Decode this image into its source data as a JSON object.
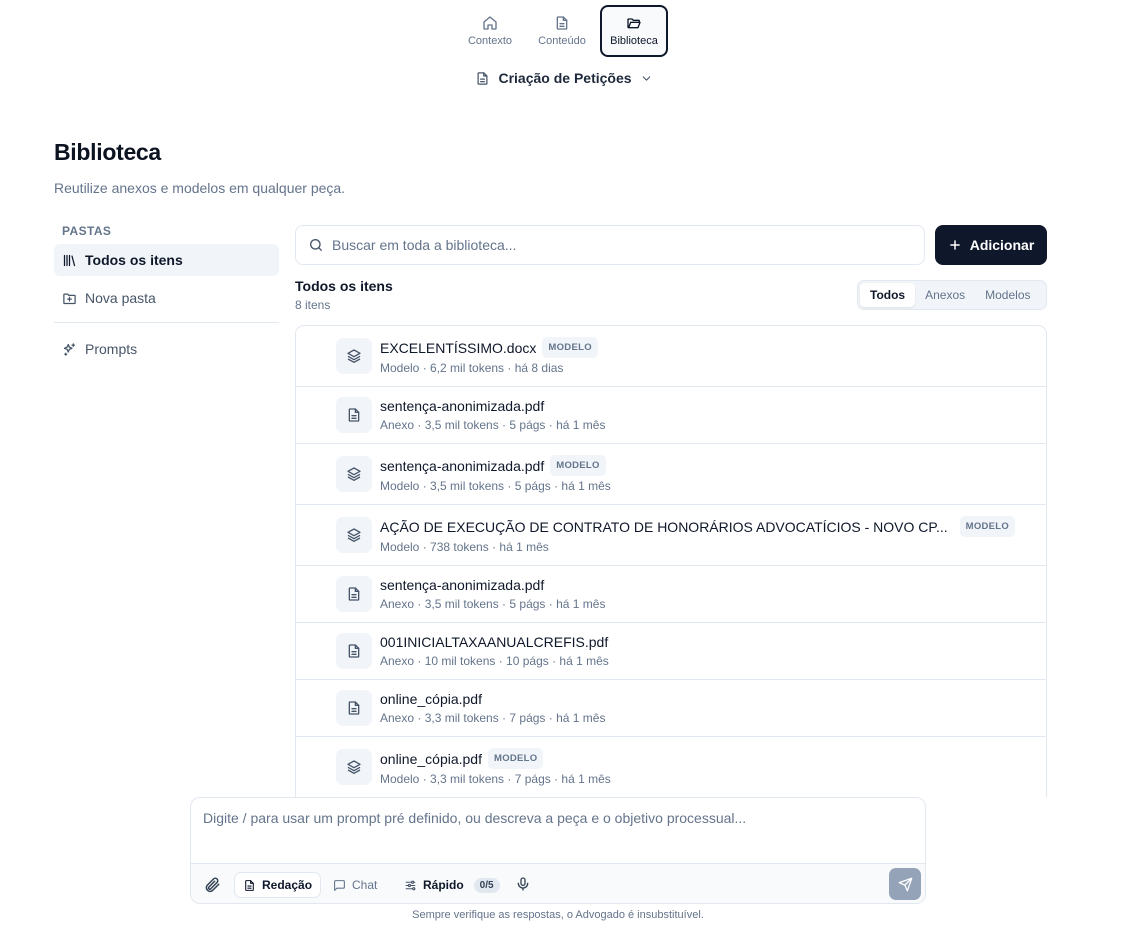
{
  "topnav": {
    "tabs": [
      {
        "label": "Contexto",
        "icon": "home-icon",
        "active": false
      },
      {
        "label": "Conteúdo",
        "icon": "document-icon",
        "active": false
      },
      {
        "label": "Biblioteca",
        "icon": "folder-open-icon",
        "active": true
      }
    ]
  },
  "case": {
    "title": "Criação de Petições"
  },
  "page": {
    "title": "Biblioteca",
    "subtitle": "Reutilize anexos e modelos em qualquer peça."
  },
  "sidebar": {
    "section": "PASTAS",
    "items": [
      {
        "label": "Todos os itens",
        "icon": "library-icon",
        "active": true
      },
      {
        "label": "Nova pasta",
        "icon": "folder-plus-icon",
        "active": false
      },
      {
        "label": "Prompts",
        "icon": "sparkles-icon",
        "active": false
      }
    ]
  },
  "search": {
    "placeholder": "Buscar em toda a biblioteca..."
  },
  "add_button": {
    "label": "Adicionar"
  },
  "list": {
    "title": "Todos os itens",
    "count": "8 itens",
    "filters": [
      {
        "label": "Todos",
        "active": true
      },
      {
        "label": "Anexos",
        "active": false
      },
      {
        "label": "Modelos",
        "active": false
      }
    ],
    "items": [
      {
        "name": "EXCELENTÍSSIMO.docx",
        "badge": "MODELO",
        "meta": "Modelo · 6,2 mil tokens · há 8 dias",
        "icon": "layers-icon"
      },
      {
        "name": "sentença-anonimizada.pdf",
        "badge": "",
        "meta": "Anexo · 3,5 mil tokens · 5 págs · há 1 mês",
        "icon": "file-text-icon"
      },
      {
        "name": "sentença-anonimizada.pdf",
        "badge": "MODELO",
        "meta": "Modelo · 3,5 mil tokens · 5 págs · há 1 mês",
        "icon": "layers-icon"
      },
      {
        "name": "AÇÃO DE EXECUÇÃO DE CONTRATO DE HONORÁRIOS ADVOCATÍCIOS - NOVO CP...",
        "badge": "MODELO",
        "meta": "Modelo · 738 tokens · há 1 mês",
        "icon": "layers-icon"
      },
      {
        "name": "sentença-anonimizada.pdf",
        "badge": "",
        "meta": "Anexo · 3,5 mil tokens · 5 págs · há 1 mês",
        "icon": "file-text-icon"
      },
      {
        "name": "001INICIALTAXAANUALCREFIS.pdf",
        "badge": "",
        "meta": "Anexo · 10 mil tokens · 10 págs · há 1 mês",
        "icon": "file-text-icon"
      },
      {
        "name": "online_cópia.pdf",
        "badge": "",
        "meta": "Anexo · 3,3 mil tokens · 7 págs · há 1 mês",
        "icon": "file-text-icon"
      },
      {
        "name": "online_cópia.pdf",
        "badge": "MODELO",
        "meta": "Modelo · 3,3 mil tokens · 7 págs · há 1 mês",
        "icon": "layers-icon"
      }
    ]
  },
  "composer": {
    "placeholder": "Digite / para usar um prompt pré definido, ou descreva a peça e o objetivo processual...",
    "modes": [
      {
        "label": "Redação",
        "active": true,
        "icon": "document-icon"
      },
      {
        "label": "Chat",
        "active": false,
        "icon": "message-icon"
      }
    ],
    "quick": {
      "label": "Rápido",
      "count": "0/5",
      "icon": "sliders-icon"
    }
  },
  "disclaimer": "Sempre verifique as respostas, o Advogado é insubstituível."
}
